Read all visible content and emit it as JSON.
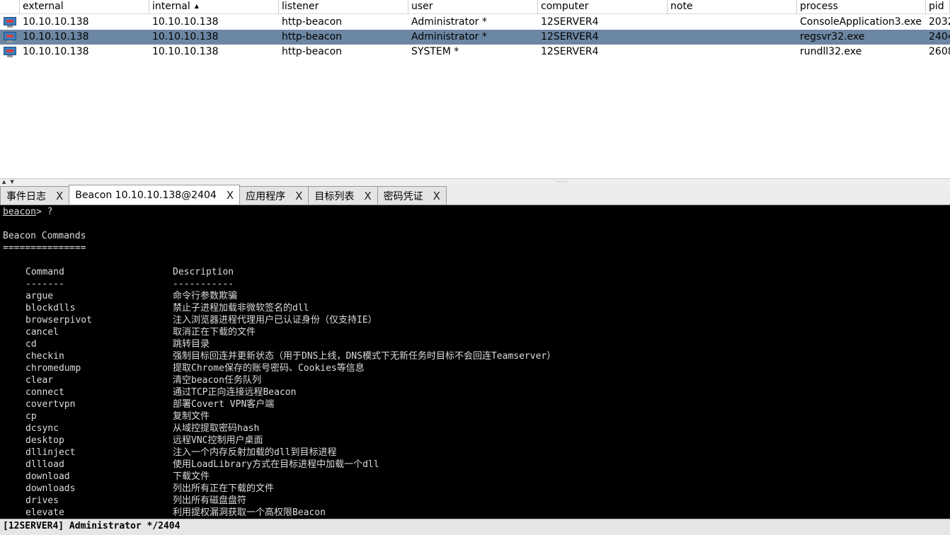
{
  "table": {
    "columns": [
      "",
      "external",
      "internal",
      "listener",
      "user",
      "computer",
      "note",
      "process",
      "pid"
    ],
    "sort_indicator": "▲",
    "rows": [
      {
        "external": "10.10.10.138",
        "internal": "10.10.10.138",
        "listener": "http-beacon",
        "user": "Administrator *",
        "computer": "12SERVER4",
        "note": "",
        "process": "ConsoleApplication3.exe",
        "pid": "2032",
        "selected": false
      },
      {
        "external": "10.10.10.138",
        "internal": "10.10.10.138",
        "listener": "http-beacon",
        "user": "Administrator *",
        "computer": "12SERVER4",
        "note": "",
        "process": "regsvr32.exe",
        "pid": "2404",
        "selected": true
      },
      {
        "external": "10.10.10.138",
        "internal": "10.10.10.138",
        "listener": "http-beacon",
        "user": "SYSTEM *",
        "computer": "12SERVER4",
        "note": "",
        "process": "rundll32.exe",
        "pid": "2608",
        "selected": false
      }
    ]
  },
  "splitter": {
    "arrows": "▲▼",
    "grip": "·····"
  },
  "tabs": [
    {
      "label": "事件日志",
      "close": "X",
      "active": false
    },
    {
      "label": "Beacon 10.10.10.138@2404",
      "close": "X",
      "active": true
    },
    {
      "label": "应用程序",
      "close": "X",
      "active": false
    },
    {
      "label": "目标列表",
      "close": "X",
      "active": false
    },
    {
      "label": "密码凭证",
      "close": "X",
      "active": false
    }
  ],
  "console": {
    "prompt": "beacon",
    "prompt_input": "> ?",
    "heading": "Beacon Commands",
    "heading_rule": "===============",
    "col_command": "Command",
    "col_description": "Description",
    "col_command_rule": "-------",
    "col_description_rule": "-----------",
    "commands": [
      {
        "name": "argue",
        "desc": "命令行参数欺骗"
      },
      {
        "name": "blockdlls",
        "desc": "禁止子进程加载非微软签名的dll"
      },
      {
        "name": "browserpivot",
        "desc": "注入浏览器进程代理用户已认证身份（仅支持IE）"
      },
      {
        "name": "cancel",
        "desc": "取消正在下载的文件"
      },
      {
        "name": "cd",
        "desc": "跳转目录"
      },
      {
        "name": "checkin",
        "desc": "强制目标回连并更新状态（用于DNS上线，DNS模式下无新任务时目标不会回连Teamserver）"
      },
      {
        "name": "chromedump",
        "desc": "提取Chrome保存的账号密码、Cookies等信息"
      },
      {
        "name": "clear",
        "desc": "清空beacon任务队列"
      },
      {
        "name": "connect",
        "desc": "通过TCP正向连接远程Beacon"
      },
      {
        "name": "covertvpn",
        "desc": "部署Covert VPN客户端"
      },
      {
        "name": "cp",
        "desc": "复制文件"
      },
      {
        "name": "dcsync",
        "desc": "从域控提取密码hash"
      },
      {
        "name": "desktop",
        "desc": "远程VNC控制用户桌面"
      },
      {
        "name": "dllinject",
        "desc": "注入一个内存反射加载的dll到目标进程"
      },
      {
        "name": "dllload",
        "desc": "使用LoadLibrary方式在目标进程中加载一个dll"
      },
      {
        "name": "download",
        "desc": "下载文件"
      },
      {
        "name": "downloads",
        "desc": "列出所有正在下载的文件"
      },
      {
        "name": "drives",
        "desc": "列出所有磁盘盘符"
      },
      {
        "name": "elevate",
        "desc": "利用提权漏洞获取一个高权限Beacon"
      }
    ]
  },
  "statusbar": {
    "text": "[12SERVER4] Administrator */2404"
  },
  "colors": {
    "selected_row": "#6c87a3",
    "console_bg": "#000000",
    "console_fg": "#dcdcdc"
  }
}
